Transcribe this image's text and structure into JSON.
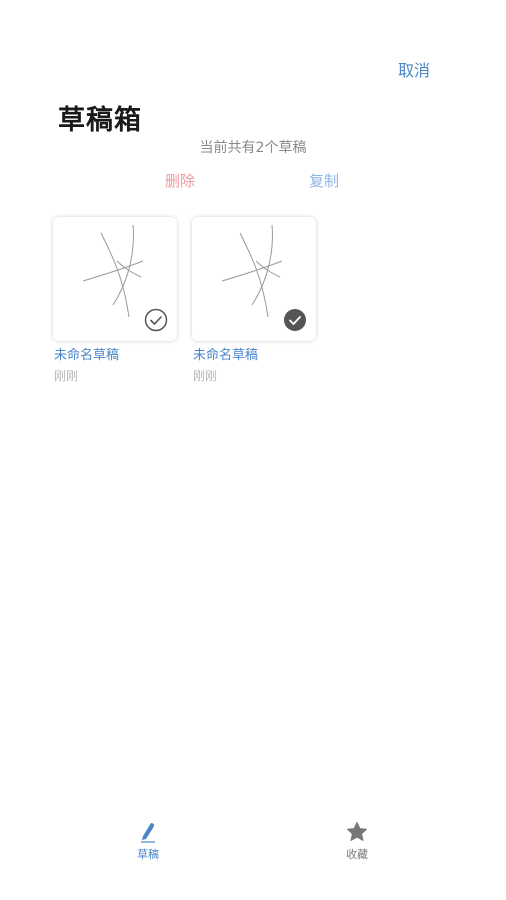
{
  "header": {
    "cancel_label": "取消",
    "title": "草稿箱",
    "count_text": "当前共有2个草稿"
  },
  "actions": {
    "delete_label": "删除",
    "copy_label": "复制"
  },
  "drafts": [
    {
      "name": "未命名草稿",
      "time": "刚刚",
      "selected": false
    },
    {
      "name": "未命名草稿",
      "time": "刚刚",
      "selected": true
    }
  ],
  "tabbar": {
    "items": [
      {
        "label": "草稿",
        "icon": "pen-icon",
        "active": true
      },
      {
        "label": "收藏",
        "icon": "star-icon",
        "active": false
      }
    ]
  },
  "colors": {
    "accent": "#4a86c8",
    "delete": "#f0999e",
    "copy": "#8fb5e4",
    "check_selected": "#555555"
  }
}
